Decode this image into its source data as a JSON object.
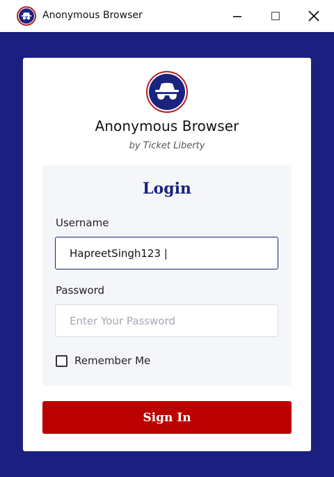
{
  "window": {
    "title": "Anonymous Browser",
    "controls": {
      "minimize_icon": "minimize-icon",
      "maximize_icon": "maximize-icon",
      "close_icon": "close-icon"
    }
  },
  "brand": {
    "name": "Anonymous Browser",
    "subtitle": "by Ticket Liberty",
    "logo_icon": "incognito-icon"
  },
  "login": {
    "heading": "Login",
    "username_label": "Username",
    "username_value": "HapreetSingh123 |",
    "password_label": "Password",
    "password_placeholder": "Enter Your Password",
    "remember_label": "Remember Me",
    "remember_checked": false,
    "submit_label": "Sign In"
  },
  "colors": {
    "brand_navy": "#1a237e",
    "frame_background": "#1a1f80",
    "accent_red": "#bb0000",
    "logo_ring": "#b01e23",
    "panel_background": "#f5f6fa"
  }
}
